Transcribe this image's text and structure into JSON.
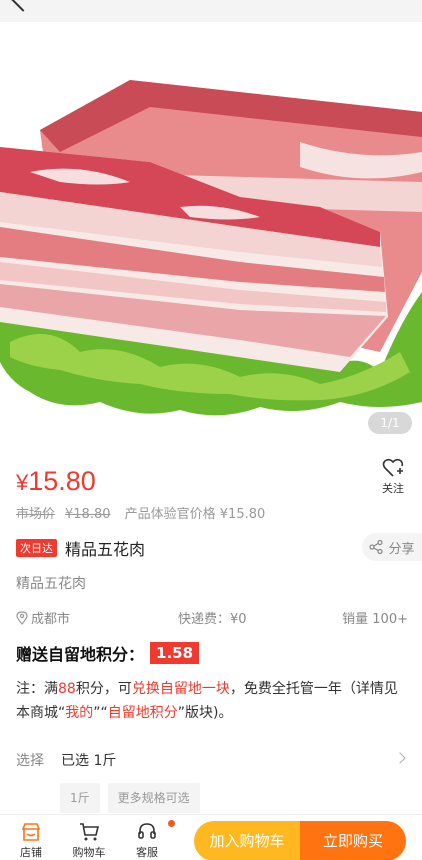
{
  "gallery": {
    "counter": "1/1"
  },
  "product": {
    "currency": "¥",
    "price": "15.80",
    "follow_label": "关注",
    "market_price_label": "市场价",
    "market_price": "¥18.80",
    "tester_price": "产品体验官价格 ¥15.80",
    "badge": "次日达",
    "title": "精品五花肉",
    "share_label": "分享",
    "subtitle": "精品五花肉",
    "location": "成都市",
    "shipping": "快递费：¥0",
    "sales": "销量 100+",
    "points_label": "赠送自留地积分：",
    "points_value": "1.58"
  },
  "note": {
    "p1": "注：满",
    "n": "88",
    "p2": "积分，可",
    "link1": "兑换自留地一块",
    "p3": "，免费全托管一年（详情见本商城“",
    "link2": "我的",
    "p4": "”“",
    "link3": "自留地积分",
    "p5": "”版块)。"
  },
  "spec": {
    "select_label": "选择",
    "selected": "已选  1斤",
    "chips": [
      "1斤",
      "更多规格可选"
    ]
  },
  "bottom": {
    "store": "店铺",
    "cart": "购物车",
    "service": "客服",
    "add_to_cart": "加入购物车",
    "buy_now": "立即购买"
  },
  "colors": {
    "accent": "#f03a2f",
    "cart_button": "#ffb81f",
    "buy_button": "#ff7311"
  }
}
